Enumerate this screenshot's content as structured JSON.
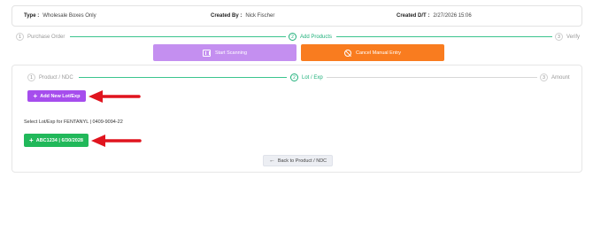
{
  "info": {
    "type_label": "Type :",
    "type_value": "Wholesale Boxes Only",
    "created_by_label": "Created By :",
    "created_by_value": "Nick Fischer",
    "created_dt_label": "Created D/T :",
    "created_dt_value": "2/27/2026 15:06"
  },
  "main_steps": [
    {
      "num": "1",
      "label": "Purchase Order"
    },
    {
      "num": "2",
      "label": "Add Products"
    },
    {
      "num": "3",
      "label": "Verify"
    }
  ],
  "actions": {
    "start_scanning": "Start Scanning",
    "cancel_manual_entry": "Cancel Manual Entry"
  },
  "sub_steps": [
    {
      "num": "1",
      "label": "Product / NDC"
    },
    {
      "num": "2",
      "label": "Lot / Exp"
    },
    {
      "num": "3",
      "label": "Amount"
    }
  ],
  "lot": {
    "add_new_label": "Add New Lot/Exp",
    "select_text": "Select Lot/Exp for FENTANYL | 0409-9094-22",
    "existing_lot": "ABC1234 | 6/30/2028",
    "back_label": "Back to Product / NDC"
  },
  "colors": {
    "accent_green": "#1fb07a",
    "scan_purple": "#c48ff0",
    "cancel_orange": "#f97c1f",
    "add_purple": "#a64ded",
    "lot_green": "#21b85a",
    "annotation_red": "#e0141e"
  }
}
